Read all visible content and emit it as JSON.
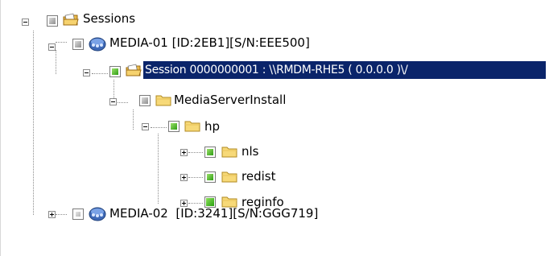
{
  "tree": {
    "root": {
      "label": "Sessions",
      "icon": "sessions-folder-icon",
      "expanded": true
    },
    "media01": {
      "label": "MEDIA-01 [ID:2EB1][S/N:EEE500]",
      "icon": "media-server-icon",
      "expanded": true
    },
    "session": {
      "label": "Session 0000000001 : \\\\RMDM-RHE5 ( 0.0.0.0 )\\/",
      "icon": "session-folder-icon",
      "selected": true,
      "expanded": true
    },
    "install": {
      "label": "MediaServerInstall",
      "icon": "folder-icon",
      "expanded": true
    },
    "hp": {
      "label": "hp",
      "icon": "folder-icon",
      "expanded": true
    },
    "nls": {
      "label": "nls",
      "icon": "folder-icon",
      "expanded": false
    },
    "redist": {
      "label": "redist",
      "icon": "folder-icon",
      "expanded": false
    },
    "reginfo": {
      "label": "reginfo",
      "icon": "folder-icon",
      "expanded": false
    },
    "media02": {
      "label": "MEDIA-02  [ID:3241][S/N:GGG719]",
      "icon": "media-server-icon",
      "expanded": false
    }
  },
  "colors": {
    "selection": "#0a246a",
    "green": "#2f9e14",
    "gray": "#8e8e8e",
    "folder": "#f5d66a"
  }
}
